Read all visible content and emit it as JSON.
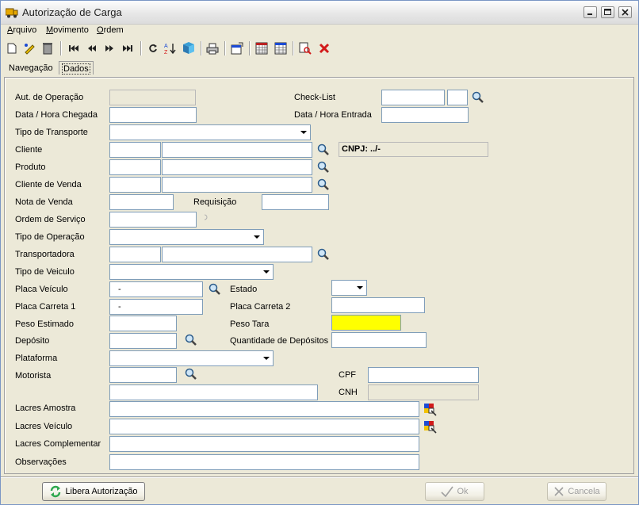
{
  "window": {
    "title": "Autorização de Carga"
  },
  "menu": [
    {
      "label": "Arquivo",
      "hotkey": "A",
      "rest": "rquivo"
    },
    {
      "label": "Movimento",
      "hotkey": "M",
      "rest": "ovimento"
    },
    {
      "label": "Ordem",
      "hotkey": "O",
      "rest": "rdem"
    }
  ],
  "toolbar": [
    "new-icon",
    "edit-icon",
    "delete-icon",
    "first-icon",
    "previous-icon",
    "next-icon",
    "last-icon",
    "refresh-icon",
    "sort-icon",
    "filter-icon",
    "print-icon",
    "properties-icon",
    "calendar-icon",
    "grid-icon",
    "find-icon",
    "close-red-icon"
  ],
  "tabs": {
    "navegacao": "Navegação",
    "dados": "Dados"
  },
  "labels": {
    "aut_operacao": "Aut. de Operação",
    "check_list": "Check-List",
    "data_hora_chegada": "Data / Hora Chegada",
    "data_hora_entrada": "Data / Hora Entrada",
    "tipo_transporte": "Tipo de Transporte",
    "cliente": "Cliente",
    "produto": "Produto",
    "cliente_venda": "Cliente de Venda",
    "nota_venda": "Nota de Venda",
    "requisicao": "Requisição",
    "ordem_servico": "Ordem de Serviço",
    "tipo_operacao": "Tipo de Operação",
    "transportadora": "Transportadora",
    "tipo_veiculo": "Tipo de Veiculo",
    "placa_veiculo": "Placa Veículo",
    "estado": "Estado",
    "placa_carreta1": "Placa Carreta 1",
    "placa_carreta2": "Placa Carreta 2",
    "peso_estimado": "Peso Estimado",
    "peso_tara": "Peso Tara",
    "deposito": "Depósito",
    "qtd_depositos": "Quantidade de Depósitos",
    "plataforma": "Plataforma",
    "motorista": "Motorista",
    "cpf": "CPF",
    "cnh": "CNH",
    "lacres_amostra": "Lacres Amostra",
    "lacres_veiculo": "Lacres Veículo",
    "lacres_complementar": "Lacres Complementar",
    "observacoes": "Observações"
  },
  "values": {
    "cnpj": "CNPJ: ../-",
    "placa_veiculo_mask": "-",
    "placa_carreta1_mask": "-"
  },
  "colors": {
    "highlight": "#ffff00",
    "accent_green": "#2fa84f",
    "accent_red": "#d21a1a"
  },
  "buttons": {
    "libera": "Libera Autorização",
    "ok": "Ok",
    "cancela": "Cancela"
  }
}
